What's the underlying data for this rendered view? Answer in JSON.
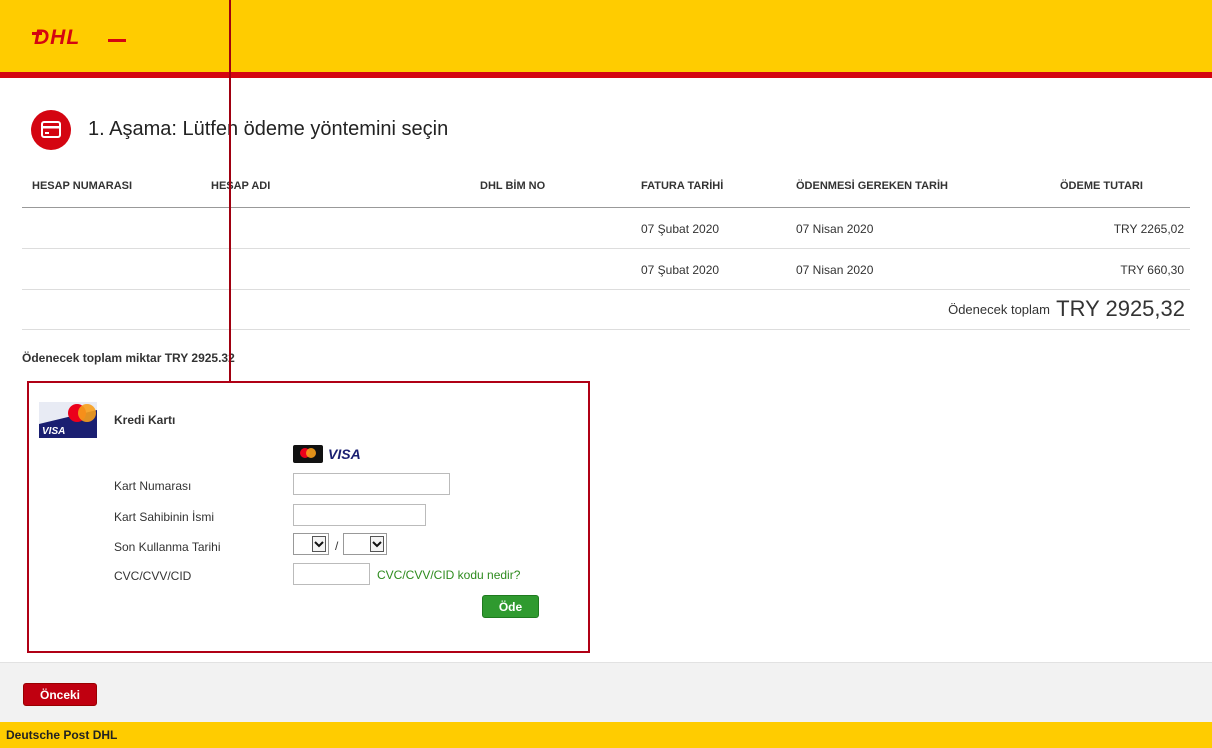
{
  "header": {
    "logo_text": "DHL"
  },
  "step": {
    "title": "1. Aşama: Lütfen ödeme yöntemini seçin"
  },
  "table": {
    "columns": [
      "HESAP NUMARASI",
      "HESAP ADI",
      "DHL BİM NO",
      "FATURA TARİHİ",
      "ÖDENMESİ GEREKEN TARİH",
      "ÖDEME TUTARI"
    ],
    "rows": [
      {
        "account_no": "",
        "account_name": "",
        "bim_no": "",
        "invoice_date": "07 Şubat 2020",
        "due_date": "07 Nisan 2020",
        "amount": "TRY 2265,02"
      },
      {
        "account_no": "",
        "account_name": "",
        "bim_no": "",
        "invoice_date": "07 Şubat 2020",
        "due_date": "07 Nisan 2020",
        "amount": "TRY 660,30"
      }
    ],
    "total_label": "Ödenecek toplam",
    "total_value": "TRY 2925,32"
  },
  "summary": {
    "total_text": "Ödenecek toplam miktar TRY 2925.32"
  },
  "payment": {
    "method_title": "Kredi Kartı",
    "card_number_label": "Kart Numarası",
    "card_number_value": "",
    "holder_label": "Kart Sahibinin İsmi",
    "holder_value": "",
    "expiry_label": "Son Kullanma Tarihi",
    "expiry_month": "",
    "expiry_year": "",
    "expiry_separator": "/",
    "cvc_label": "CVC/CVV/CID",
    "cvc_value": "",
    "cvc_help_link": "CVC/CVV/CID kodu nedir?",
    "pay_button": "Öde",
    "visa_text": "VISA",
    "mastercard_text": "MasterCard"
  },
  "nav": {
    "prev_button": "Önceki"
  },
  "footer": {
    "text": "Deutsche Post DHL"
  },
  "colors": {
    "yellow": "#ffcc00",
    "red": "#d40511",
    "green": "#2f9a2f"
  }
}
